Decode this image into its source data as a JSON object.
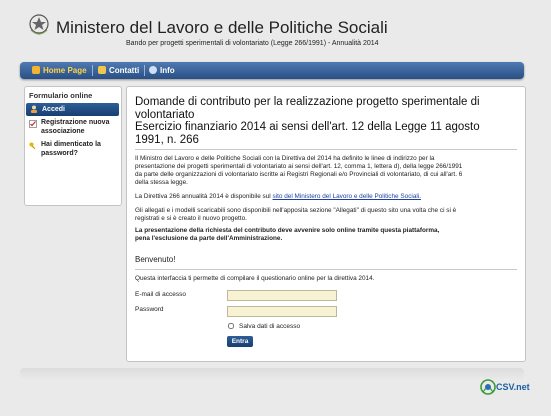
{
  "header": {
    "ministry_title": "Ministero del Lavoro e delle Politiche Sociali",
    "subtitle": "Bando per progetti sperimentali di volontariato (Legge 266/1991) - Annualità 2014"
  },
  "nav": {
    "items": [
      {
        "label": "Home Page",
        "icon": "home-icon",
        "active": true
      },
      {
        "label": "Contatti",
        "icon": "folder-icon",
        "active": false
      },
      {
        "label": "Info",
        "icon": "info-icon",
        "active": false
      }
    ]
  },
  "sidebar": {
    "title": "Formulario online",
    "items": [
      {
        "label": "Accedi",
        "icon": "user-icon",
        "active": true
      },
      {
        "label_line1": "Registrazione nuova",
        "label_line2": "associazione",
        "icon": "checklist-icon"
      },
      {
        "label_line1": "Hai dimenticato la",
        "label_line2": "password?",
        "icon": "key-icon"
      }
    ]
  },
  "main": {
    "title_line1": "Domande di contributo per la realizzazione progetto sperimentale di",
    "title_line2": "volontariato",
    "title_line3": "Esercizio finanziario 2014 ai sensi dell'art. 12 della Legge 11 agosto",
    "title_line4": "1991, n. 266",
    "para1_line1": "Il Ministro del Lavoro e delle Politiche Sociali con la Direttiva del 2014 ha definito le linee di indirizzo per la",
    "para1_line2": "presentazione dei progetti sperimentali di volontariato ai sensi dell'art. 12, comma 1, lettera d), della legge 266/1991",
    "para1_line3": "da parte delle organizzazioni di volontariato iscritte ai Registri Regionali e/o Provinciali di volontariato, di cui all'art. 6",
    "para1_line4": "della stessa legge.",
    "para2_prefix": "La Direttiva 266 annualità 2014 è disponibile sul",
    "para2_link": "sito del Ministero del Lavoro e delle Politiche Sociali.",
    "para3_line1": "Gli allegati e i modelli scaricabili sono disponibili nell'apposita sezione \"Allegati\" di questo sito una volta che ci si è",
    "para3_line2": "registrati e si è creato il nuovo progetto.",
    "para4_line1": "La presentazione della richiesta del contributo deve avvenire solo online tramite questa piattaforma,",
    "para4_line2": "pena l'esclusione da parte dell'Amministrazione.",
    "welcome": "Benvenuto!",
    "intro": "Questa interfaccia ti permette di compilare il questionario online per la direttiva 2014.",
    "email_label": "E-mail di accesso",
    "email_value": "",
    "password_label": "Password",
    "password_value": "",
    "remember_label": "Salva dati di accesso",
    "submit_label": "Entra"
  },
  "footer": {
    "logo_text": "CSV.net"
  }
}
